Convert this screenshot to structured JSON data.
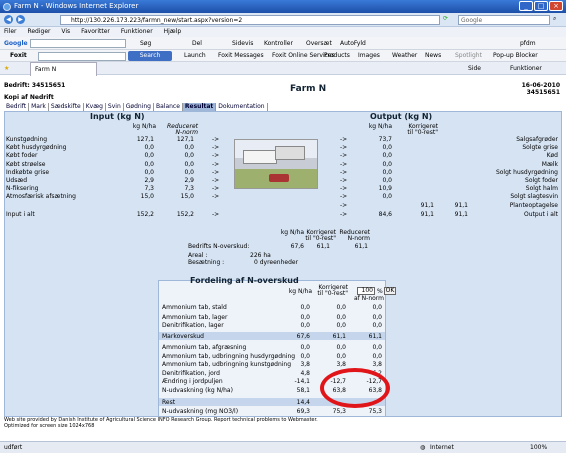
{
  "window": {
    "title": "Farm N - Windows Internet Explorer"
  },
  "address": {
    "url": "http://130.226.173.223/farmn_new/start.aspx?version=2",
    "search": "Google"
  },
  "menu": [
    "Filer",
    "Rediger",
    "Vis",
    "Favoritter",
    "Funktioner",
    "Hjælp"
  ],
  "toolbar1": {
    "google": "Google",
    "search_btn": "Søg",
    "items": [
      "Del",
      "Sidevis",
      "Kontroller",
      "Oversæt",
      "AutoFyld"
    ],
    "signin": "pfdm"
  },
  "toolbar2": {
    "brand": "Foxit",
    "search_btn": "Search",
    "items": [
      "Launch",
      "Foxit Messages",
      "Foxit Online Services",
      "Products",
      "Images",
      "Weather",
      "News",
      "Spotlight",
      "Pop-up Blocker"
    ]
  },
  "tab": {
    "label": "Farm N",
    "page_menu": "Side",
    "tools_menu": "Funktioner"
  },
  "header": {
    "bedrift": "Bedrift: 34515651",
    "title": "Farm N",
    "date": "16-06-2010",
    "id": "34515651",
    "kopi": "Kopi af Nedrift"
  },
  "tabs": [
    "Bedrift",
    "Mark",
    "Sædskifte",
    "Kvæg",
    "Svin",
    "Gødning",
    "Balance",
    "Resultat",
    "Dokumentation"
  ],
  "input": {
    "title": "Input (kg N)",
    "col1": "kg N/ha",
    "col2": "Reduceret",
    "col2b": "N-norm",
    "rows": [
      [
        "Kunstgødning",
        "127,1",
        "127,1"
      ],
      [
        "Købt husdyrgødning",
        "0,0",
        "0,0"
      ],
      [
        "Købt foder",
        "0,0",
        "0,0"
      ],
      [
        "Købt strøelse",
        "0,0",
        "0,0"
      ],
      [
        "Indkøbte grise",
        "0,0",
        "0,0"
      ],
      [
        "Udsæd",
        "2,9",
        "2,9"
      ],
      [
        "N-fiksering",
        "7,3",
        "7,3"
      ],
      [
        "Atmosfærisk afsætning",
        "15,0",
        "15,0"
      ]
    ],
    "total": [
      "Input i alt",
      "152,2",
      "152,2"
    ]
  },
  "output": {
    "title": "Output (kg N)",
    "col1": "kg N/ha",
    "col2": "Korrigeret",
    "col2b": "til \"0-rest\"",
    "rows": [
      [
        "Salgsafgrøder",
        "73,7",
        ""
      ],
      [
        "Solgte grise",
        "0,0",
        ""
      ],
      [
        "Kød",
        "0,0",
        ""
      ],
      [
        "Mælk",
        "0,0",
        ""
      ],
      [
        "Solgt husdyrgødning",
        "0,0",
        ""
      ],
      [
        "Solgt foder",
        "0,0",
        ""
      ],
      [
        "Solgt halm",
        "10,9",
        ""
      ],
      [
        "Solgt slagtesvin",
        "0,0",
        ""
      ],
      [
        "Planteoptagelse",
        "",
        "91,1",
        "91,1"
      ]
    ],
    "total": [
      "Output i alt",
      "84,6",
      "91,1",
      "91,1"
    ]
  },
  "summary": {
    "h1": "kg N/ha",
    "h2": "Korrigeret",
    "h2b": "til \"0-rest\"",
    "h3": "Reduceret",
    "h3b": "N-norm",
    "overskud_label": "Bedrifts N-overskud:",
    "overskud": [
      "67,6",
      "61,1",
      "61,1"
    ],
    "areal_label": "Areal :",
    "areal": "226 ha",
    "besaetning_label": "Besætning :",
    "besaetning": "0 dyreenheder"
  },
  "fordeling": {
    "title": "Fordeling af N-overskud",
    "h1": "kg N/ha",
    "h2": "Korrigeret",
    "h2b": "til \"0-rest\"",
    "h3": "af N-norm",
    "input_val": "100",
    "unit": "%",
    "ok": "OK",
    "rows": [
      [
        "Ammonium tab, stald",
        "0,0",
        "0,0",
        "0,0"
      ],
      [
        "Ammonium tab, lager",
        "0,0",
        "0,0",
        "0,0"
      ],
      [
        "Denitrifikation, lager",
        "0,0",
        "0,0",
        "0,0"
      ],
      [
        "Markoverskud",
        "67,6",
        "61,1",
        "61,1"
      ],
      [
        "Ammonium tab, afgræsning",
        "0,0",
        "0,0",
        "0,0"
      ],
      [
        "Ammonium tab, udbringning husdyrgødning",
        "0,0",
        "0,0",
        "0,0"
      ],
      [
        "Ammonium tab, udbringning kunstgødning",
        "3,8",
        "3,8",
        "3,8"
      ],
      [
        "Denitrifikation, jord",
        "4,8",
        "",
        "6,2"
      ],
      [
        "Ændring i jordpuljen",
        "-14,1",
        "-12,7",
        "-12,7"
      ],
      [
        "N-udvaskning (kg N/ha)",
        "58,1",
        "63,8",
        "63,8"
      ],
      [
        "Rest",
        "14,4",
        "",
        ""
      ],
      [
        "N-udvaskning (mg NO3/l)",
        "69,3",
        "75,3",
        "75,3"
      ]
    ]
  },
  "footer": {
    "line1": "Web site provided by Danish Institute of Agricultural Science INFO Research Group. Report technical problems to Webmaster.",
    "line2": "Optimized for screen size 1024x768"
  },
  "status": {
    "left": "udført",
    "zone": "Internet",
    "zoom": "100%"
  }
}
